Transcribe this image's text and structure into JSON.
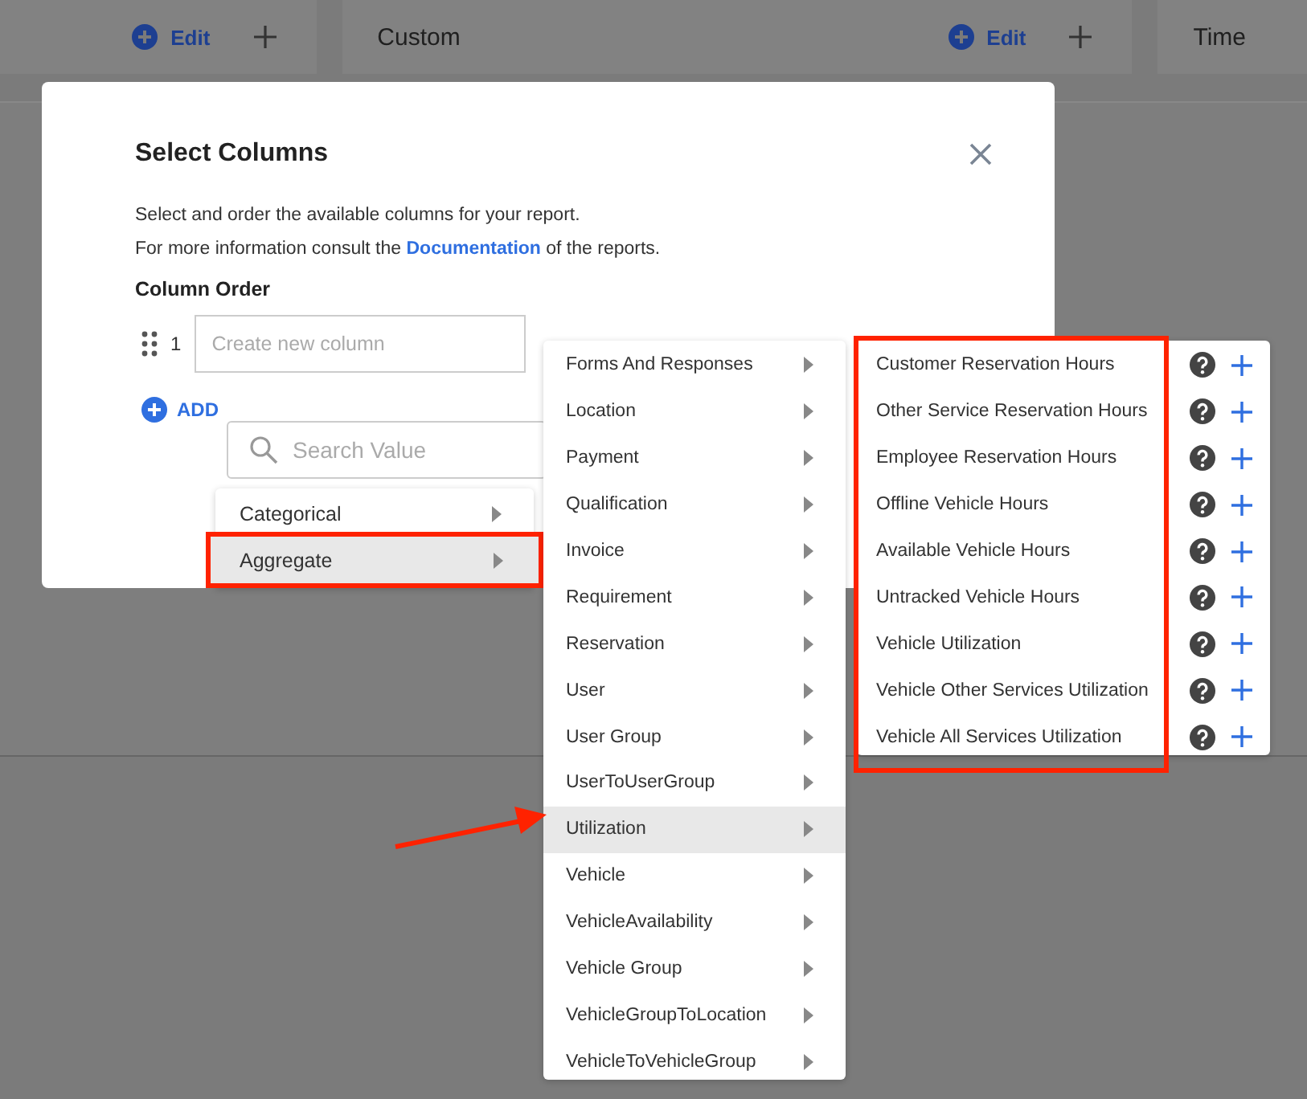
{
  "background_cards": [
    {
      "edit": "Edit"
    },
    {
      "title": "Custom",
      "edit": "Edit"
    },
    {
      "title": "Time"
    }
  ],
  "dialog": {
    "title": "Select Columns",
    "intro": "Select and order the available columns for your report.",
    "info": {
      "before": "For more information consult the ",
      "link": "Documentation",
      "after": " of the reports."
    },
    "section": "Column Order",
    "rows": [
      {
        "index": "1",
        "placeholder": "Create new column"
      }
    ],
    "add_label": "ADD"
  },
  "search": {
    "placeholder": "Search Value"
  },
  "menu_1": [
    {
      "label": "Categorical",
      "selected": false,
      "outlined": false
    },
    {
      "label": "Aggregate",
      "selected": true,
      "outlined": true
    }
  ],
  "menu_2": [
    {
      "label": "Forms And Responses",
      "selected": false,
      "pointed": false
    },
    {
      "label": "Location",
      "selected": false,
      "pointed": false
    },
    {
      "label": "Payment",
      "selected": false,
      "pointed": false
    },
    {
      "label": "Qualification",
      "selected": false,
      "pointed": false
    },
    {
      "label": "Invoice",
      "selected": false,
      "pointed": false
    },
    {
      "label": "Requirement",
      "selected": false,
      "pointed": false
    },
    {
      "label": "Reservation",
      "selected": false,
      "pointed": false
    },
    {
      "label": "User",
      "selected": false,
      "pointed": false
    },
    {
      "label": "User Group",
      "selected": false,
      "pointed": false
    },
    {
      "label": "UserToUserGroup",
      "selected": false,
      "pointed": false
    },
    {
      "label": "Utilization",
      "selected": true,
      "pointed": true
    },
    {
      "label": "Vehicle",
      "selected": false,
      "pointed": false
    },
    {
      "label": "VehicleAvailability",
      "selected": false,
      "pointed": false
    },
    {
      "label": "Vehicle Group",
      "selected": false,
      "pointed": false
    },
    {
      "label": "VehicleGroupToLocation",
      "selected": false,
      "pointed": false
    },
    {
      "label": "VehicleToVehicleGroup",
      "selected": false,
      "pointed": false
    }
  ],
  "menu_3": {
    "outlined": true,
    "items": [
      {
        "label": "Customer Reservation Hours"
      },
      {
        "label": "Other Service Reservation Hours"
      },
      {
        "label": "Employee Reservation Hours"
      },
      {
        "label": "Offline Vehicle Hours"
      },
      {
        "label": "Available Vehicle Hours"
      },
      {
        "label": "Untracked Vehicle Hours"
      },
      {
        "label": "Vehicle Utilization"
      },
      {
        "label": "Vehicle Other Services Utilization"
      },
      {
        "label": "Vehicle All Services Utilization"
      }
    ]
  }
}
